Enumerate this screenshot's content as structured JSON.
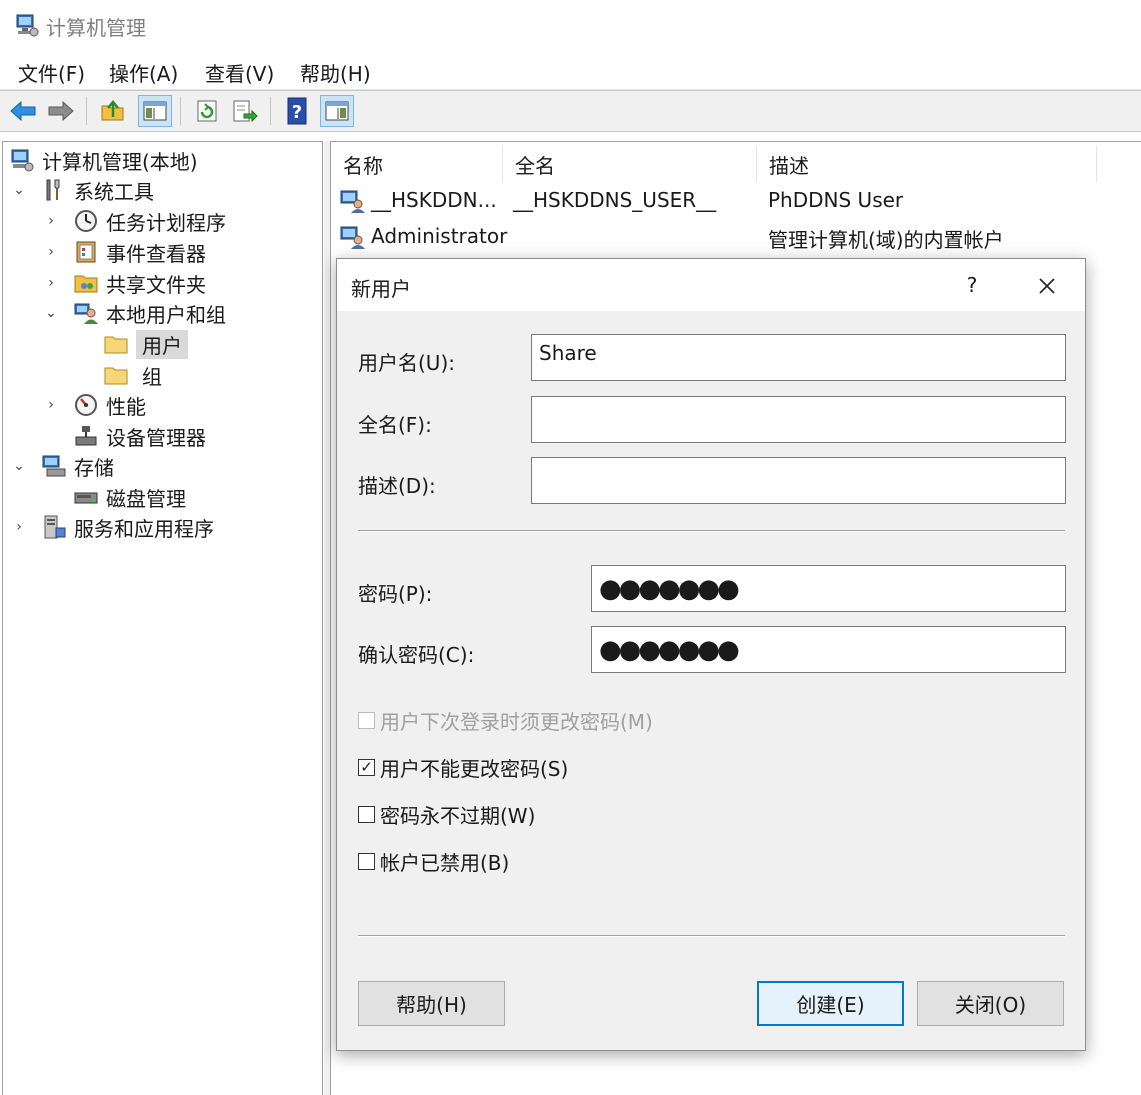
{
  "window": {
    "title": "计算机管理"
  },
  "menu": [
    "文件(F)",
    "操作(A)",
    "查看(V)",
    "帮助(H)"
  ],
  "toolbar": {
    "icons": [
      "back-arrow-icon",
      "forward-arrow-icon",
      "up-folder-icon",
      "show-hide-tree-icon",
      "refresh-icon",
      "export-list-icon",
      "help-icon",
      "show-action-pane-icon"
    ]
  },
  "tree": {
    "root": "计算机管理(本地)",
    "system_tools": "系统工具",
    "task_scheduler": "任务计划程序",
    "event_viewer": "事件查看器",
    "shared_folders": "共享文件夹",
    "local_users_groups": "本地用户和组",
    "users": "用户",
    "groups": "组",
    "performance": "性能",
    "device_manager": "设备管理器",
    "storage": "存储",
    "disk_management": "磁盘管理",
    "services_apps": "服务和应用程序"
  },
  "list": {
    "columns": [
      "名称",
      "全名",
      "描述"
    ],
    "rows": [
      {
        "name": "__HSKDDN...",
        "fullname": "__HSKDDNS_USER__",
        "description": "PhDDNS User"
      },
      {
        "name": "Administrator",
        "fullname": "",
        "description": "管理计算机(域)的内置帐户"
      }
    ]
  },
  "dialog": {
    "title": "新用户",
    "help_glyph": "?",
    "username_label": "用户名(U):",
    "username_value": "Share",
    "fullname_label": "全名(F):",
    "fullname_value": "",
    "description_label": "描述(D):",
    "description_value": "",
    "password_label": "密码(P):",
    "password_value": "●●●●●●●",
    "confirm_label": "确认密码(C):",
    "confirm_value": "●●●●●●●",
    "checkboxes": [
      {
        "label": "用户下次登录时须更改密码(M)",
        "checked": false,
        "disabled": true,
        "mark": ""
      },
      {
        "label": "用户不能更改密码(S)",
        "checked": true,
        "disabled": false,
        "mark": "✓"
      },
      {
        "label": "密码永不过期(W)",
        "checked": false,
        "disabled": false,
        "mark": ""
      },
      {
        "label": "帐户已禁用(B)",
        "checked": false,
        "disabled": false,
        "mark": ""
      }
    ],
    "help_button": "帮助(H)",
    "create_button": "创建(E)",
    "close_button": "关闭(O)"
  }
}
